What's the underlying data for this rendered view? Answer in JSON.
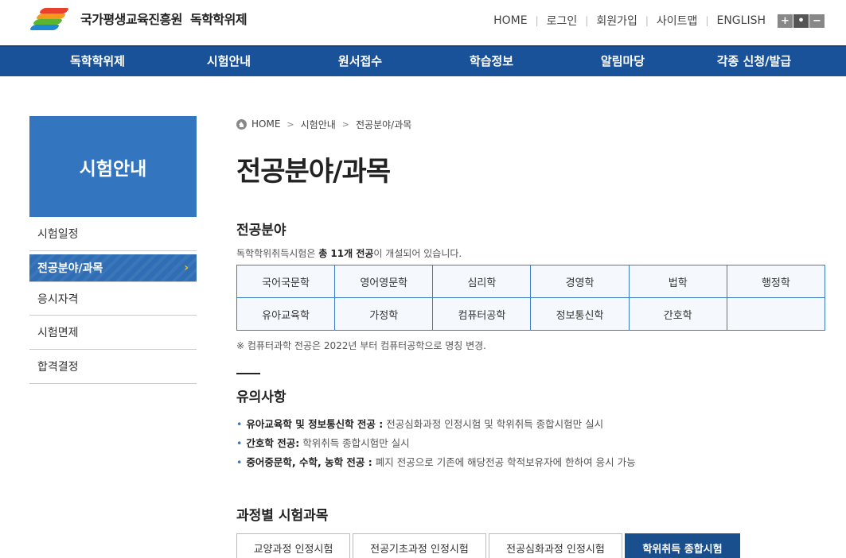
{
  "header": {
    "org_name": "국가평생교육진흥원",
    "site_name": "독학학위제",
    "util_links": [
      "HOME",
      "로그인",
      "회원가입",
      "사이트맵",
      "ENGLISH"
    ],
    "zoom_in": "+",
    "zoom_reset": "•",
    "zoom_out": "−"
  },
  "gnb": [
    "독학학위제",
    "시험안내",
    "원서접수",
    "학습정보",
    "알림마당",
    "각종 신청/발급"
  ],
  "lnb": {
    "title": "시험안내",
    "items": [
      "시험일정",
      "전공분야/과목",
      "응시자격",
      "시험면제",
      "합격결정"
    ],
    "active_chevron": "›"
  },
  "breadcrumb": [
    "HOME",
    "시험안내",
    "전공분야/과목"
  ],
  "page_title": "전공분야/과목",
  "majors": {
    "title": "전공분야",
    "desc_prefix": "독학학위취득시험은",
    "desc_bold": "총 11개 전공",
    "desc_suffix": "이 개설되어 있습니다.",
    "rows": [
      [
        "국어국문학",
        "영어영문학",
        "심리학",
        "경영학",
        "법학",
        "행정학"
      ],
      [
        "유아교육학",
        "가정학",
        "컴퓨터공학",
        "정보통신학",
        "간호학",
        ""
      ]
    ],
    "note": "※ 컴퓨터과학 전공은 2022년 부터 컴퓨터공학으로 명칭 변경."
  },
  "caution": {
    "title": "유의사항",
    "items": [
      {
        "bold": "유아교육학 및 정보통신학 전공 :",
        "text": " 전공심화과정 인정시험 및 학위취득 종합시험만 실시"
      },
      {
        "bold": "간호학 전공:",
        "text": " 학위취득 종합시험만 실시"
      },
      {
        "bold": "중어중문학, 수학, 농학 전공 :",
        "text": " 폐지 전공으로 기존에 해당전공 학적보유자에 한하여 응시 가능"
      }
    ]
  },
  "subjects": {
    "title": "과정별 시험과목",
    "tabs": [
      "교양과정 인정시험",
      "전공기초과정 인정시험",
      "전공심화과정 인정시험",
      "학위취득 종합시험"
    ]
  },
  "colors": {
    "gnb_bg": "#1a5299",
    "lnb_title_bg": "#3475c0",
    "table_border": "#3b7cc4",
    "active_tab_bg": "#1a4f8e"
  }
}
